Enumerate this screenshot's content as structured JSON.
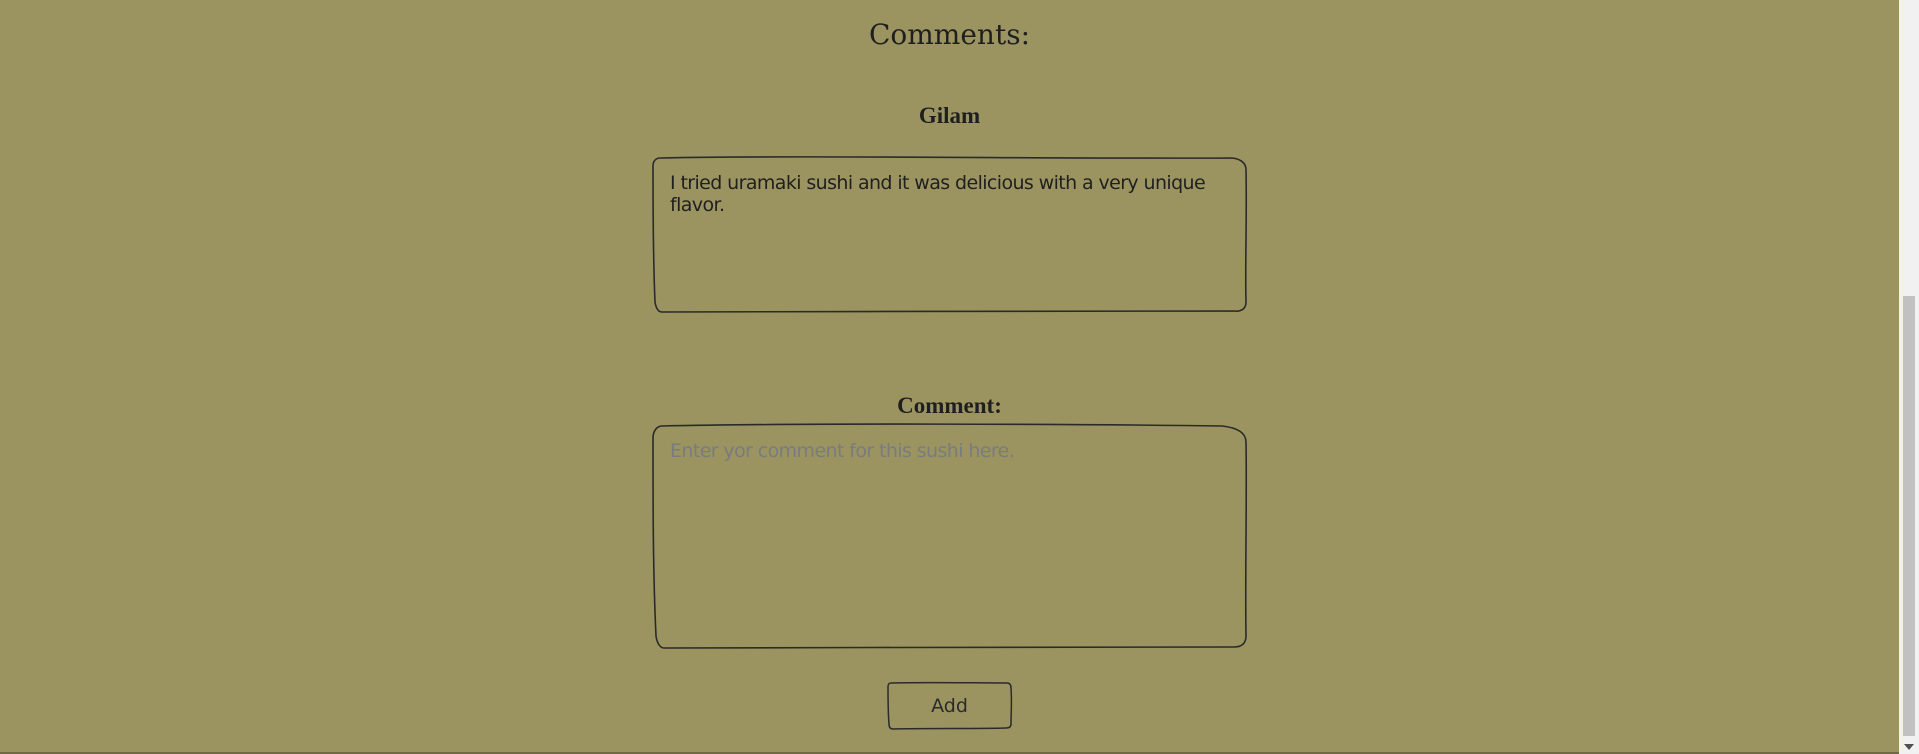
{
  "page": {
    "section_title": "Comments:",
    "background_color": "#9b9461"
  },
  "comments": [
    {
      "author": "Gilam",
      "text": "I tried uramaki sushi and it was delicious with a very unique flavor."
    }
  ],
  "form": {
    "label": "Comment:",
    "input_value": "",
    "input_placeholder": "Enter yor comment for this sushi here.",
    "add_label": "Add"
  },
  "icons": {
    "scroll_down": "chevron-down-icon"
  }
}
